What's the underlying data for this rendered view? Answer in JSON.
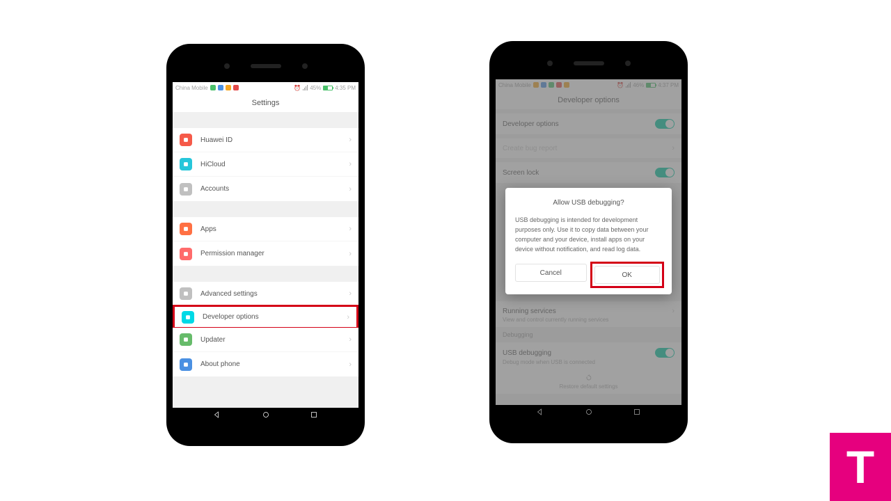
{
  "phone1": {
    "statusbar": {
      "carrier": "China Mobile",
      "battery": "45%",
      "time": "4:35 PM"
    },
    "title": "Settings",
    "groups": [
      {
        "items": [
          {
            "key": "huawei-id",
            "label": "Huawei ID",
            "color": "c-red"
          },
          {
            "key": "hicloud",
            "label": "HiCloud",
            "color": "c-teal"
          },
          {
            "key": "accounts",
            "label": "Accounts",
            "color": "c-gray"
          }
        ]
      },
      {
        "items": [
          {
            "key": "apps",
            "label": "Apps",
            "color": "c-orange"
          },
          {
            "key": "permission",
            "label": "Permission manager",
            "color": "c-pink"
          }
        ]
      },
      {
        "items": [
          {
            "key": "advanced",
            "label": "Advanced settings",
            "color": "c-gray"
          },
          {
            "key": "developer",
            "label": "Developer options",
            "color": "c-cyan",
            "highlighted": true
          },
          {
            "key": "updater",
            "label": "Updater",
            "color": "c-green"
          },
          {
            "key": "about",
            "label": "About phone",
            "color": "c-blue"
          }
        ]
      }
    ]
  },
  "phone2": {
    "statusbar": {
      "carrier": "China Mobile",
      "battery": "46%",
      "time": "4:37 PM"
    },
    "title": "Developer options",
    "rows": {
      "dev_opt": "Developer options",
      "bug_report": "Create bug report",
      "screen_lock": "Screen lock",
      "running": "Running services",
      "running_sub": "View and control currently running services",
      "debugging": "Debugging",
      "usb": "USB debugging",
      "usb_sub": "Debug mode when USB is connected",
      "restore": "Restore default settings"
    },
    "dialog": {
      "title": "Allow USB debugging?",
      "body": "USB debugging is intended for development purposes only. Use it to copy data between your computer and your device, install apps on your device without notification, and read log data.",
      "cancel": "Cancel",
      "ok": "OK"
    }
  },
  "badge": "T"
}
